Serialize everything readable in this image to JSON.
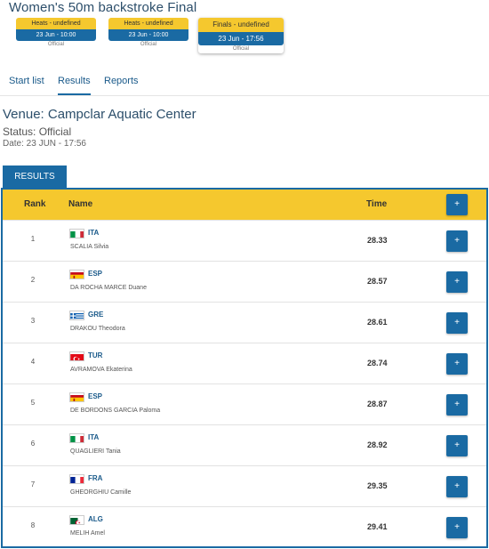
{
  "event_title": "Women's 50m backstroke Final",
  "phases": [
    {
      "name": "Heats - undefined",
      "datetime": "23 Jun - 10:00",
      "status": "Official"
    },
    {
      "name": "Heats - undefined",
      "datetime": "23 Jun - 10:00",
      "status": "Official"
    },
    {
      "name": "Finals - undefined",
      "datetime": "23 Jun - 17:56",
      "status": "Official"
    }
  ],
  "tabs": [
    "Start list",
    "Results",
    "Reports"
  ],
  "venue": "Venue: Campclar Aquatic Center",
  "status": "Status: Official",
  "date": "Date: 23 JUN - 17:56",
  "results_tab": "RESULTS",
  "table": {
    "headers": {
      "rank": "Rank",
      "name": "Name",
      "time": "Time"
    },
    "action_icon": "plus-icon",
    "rows": [
      {
        "rank": "1",
        "country": "ITA",
        "flag": "italy-flag",
        "name": "SCALIA Silvia",
        "time": "28.33"
      },
      {
        "rank": "2",
        "country": "ESP",
        "flag": "spain-flag",
        "name": "DA ROCHA MARCE Duane",
        "time": "28.57"
      },
      {
        "rank": "3",
        "country": "GRE",
        "flag": "greece-flag",
        "name": "DRAKOU Theodora",
        "time": "28.61"
      },
      {
        "rank": "4",
        "country": "TUR",
        "flag": "turkey-flag",
        "name": "AVRAMOVA Ekaterina",
        "time": "28.74"
      },
      {
        "rank": "5",
        "country": "ESP",
        "flag": "spain-flag",
        "name": "DE BORDONS GARCIA Paloma",
        "time": "28.87"
      },
      {
        "rank": "6",
        "country": "ITA",
        "flag": "italy-flag",
        "name": "QUAGLIERI Tania",
        "time": "28.92"
      },
      {
        "rank": "7",
        "country": "FRA",
        "flag": "france-flag",
        "name": "GHEORGHIU Camille",
        "time": "29.35"
      },
      {
        "rank": "8",
        "country": "ALG",
        "flag": "algeria-flag",
        "name": "MELIH Amel",
        "time": "29.41"
      }
    ]
  },
  "colors": {
    "accent_blue": "#1a6aa3",
    "header_yellow": "#f5c82e",
    "title_blue": "#2d4f6b"
  }
}
